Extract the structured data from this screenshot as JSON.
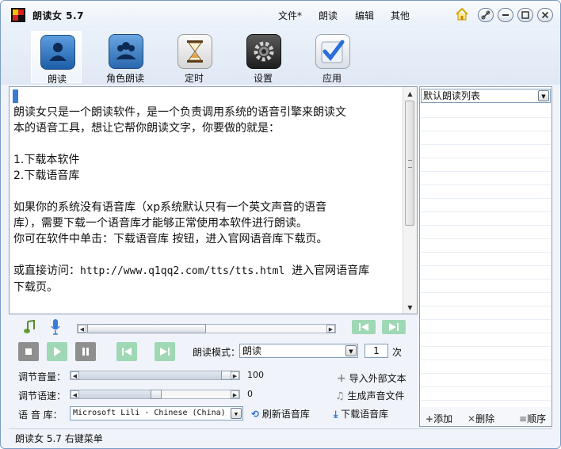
{
  "app": {
    "title": "朗读女 5.7"
  },
  "menus": [
    "文件*",
    "朗读",
    "编辑",
    "其他"
  ],
  "toolbar": {
    "tools": [
      {
        "label": "朗读",
        "icon": "reader-person-icon"
      },
      {
        "label": "角色朗读",
        "icon": "group-people-icon"
      },
      {
        "label": "定时",
        "icon": "hourglass-icon"
      },
      {
        "label": "设置",
        "icon": "gear-icon"
      },
      {
        "label": "应用",
        "icon": "checkmark-icon"
      }
    ]
  },
  "editor": {
    "line1": "朗读女只是一个朗读软件，是一个负责调用系统的语音引擎来朗读文",
    "line2": "本的语音工具，想让它帮你朗读文字，你要做的就是：",
    "item1": "1.下载本软件",
    "item2": "2.下载语音库",
    "p2a": "如果你的系统没有语音库（xp系统默认只有一个英文声音的语音",
    "p2b": "库），需要下载一个语音库才能够正常使用本软件进行朗读。",
    "p2c": "你可在软件中单击：下载语音库 按钮，进入官网语音库下载页。",
    "p3a_prefix": "或直接访问：",
    "p3a_url": "http://www.q1qq2.com/tts/tts.html",
    "p3a_suffix": "  进入官网语音库",
    "p3b": "下载页。"
  },
  "right_panel": {
    "list_select": "默认朗读列表",
    "add_label": "添加",
    "delete_label": "删除",
    "order_label": "顺序"
  },
  "controls": {
    "progress": 0.0,
    "mode_label": "朗读模式：",
    "mode_value": "朗读",
    "repeat_count": "1",
    "repeat_unit": "次",
    "volume_label": "调节音量：",
    "volume_value": "100",
    "volume_level": 1.0,
    "speed_label": "调节语速：",
    "speed_value": "0",
    "speed_level": 0.5,
    "voice_label": "语 音 库：",
    "voice_value": "Microsoft Lili - Chinese (China)",
    "refresh_label": "刷新语音库",
    "download_label": "下载语音库",
    "import_label": "导入外部文本",
    "generate_label": "生成声音文件"
  },
  "status": {
    "text": "朗读女 5.7 右键菜单"
  },
  "colors": {
    "accent": "#3a7bd5",
    "play_green": "#9fd8b4",
    "title_bg": "#e9f0f9"
  }
}
